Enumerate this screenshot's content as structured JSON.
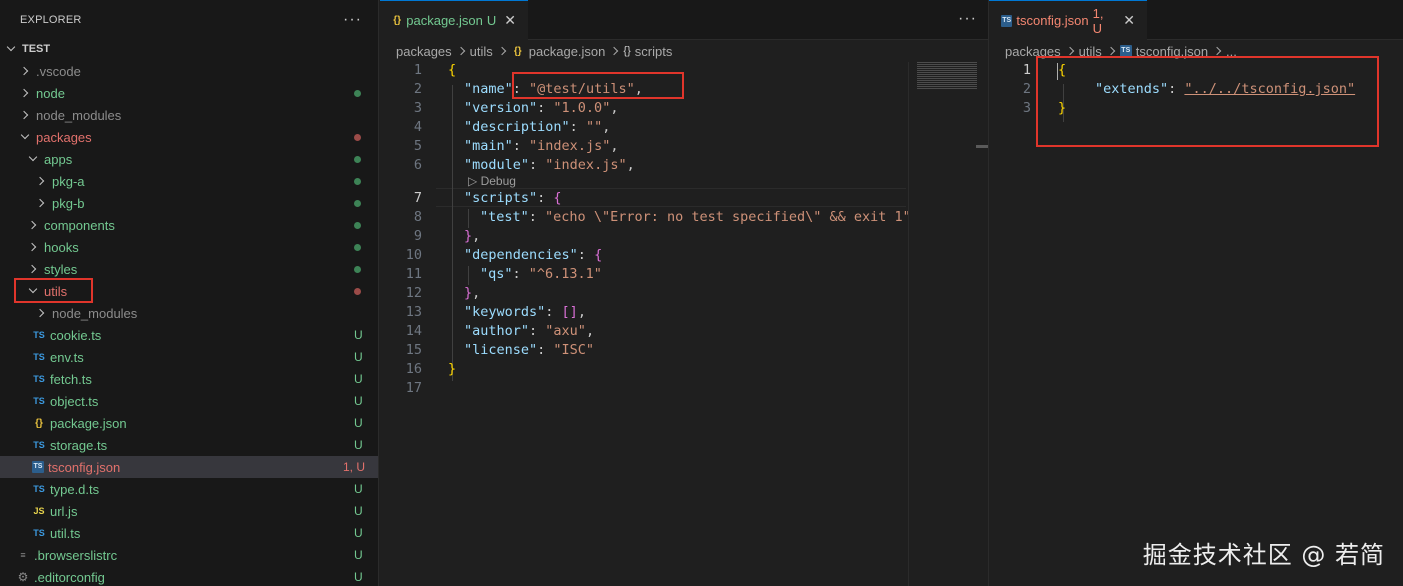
{
  "explorer": {
    "title": "EXPLORER",
    "more": "···",
    "root": "TEST",
    "items": [
      {
        "label": ".vscode",
        "type": "folder"
      },
      {
        "label": "node",
        "type": "folder"
      },
      {
        "label": "node_modules",
        "type": "folder"
      },
      {
        "label": "packages",
        "type": "folder"
      },
      {
        "label": "apps",
        "type": "folder"
      },
      {
        "label": "pkg-a",
        "type": "folder"
      },
      {
        "label": "pkg-b",
        "type": "folder"
      },
      {
        "label": "components",
        "type": "folder"
      },
      {
        "label": "hooks",
        "type": "folder"
      },
      {
        "label": "styles",
        "type": "folder"
      },
      {
        "label": "utils",
        "type": "folder"
      },
      {
        "label": "node_modules",
        "type": "folder"
      },
      {
        "label": "cookie.ts",
        "status": "U",
        "icon_text": "TS"
      },
      {
        "label": "env.ts",
        "status": "U",
        "icon_text": "TS"
      },
      {
        "label": "fetch.ts",
        "status": "U",
        "icon_text": "TS"
      },
      {
        "label": "object.ts",
        "status": "U",
        "icon_text": "TS"
      },
      {
        "label": "package.json",
        "status": "U",
        "icon_text": "{}"
      },
      {
        "label": "storage.ts",
        "status": "U",
        "icon_text": "TS"
      },
      {
        "label": "tsconfig.json",
        "status": "1, U",
        "icon_text": "TS"
      },
      {
        "label": "type.d.ts",
        "status": "U",
        "icon_text": "TS"
      },
      {
        "label": "url.js",
        "status": "U",
        "icon_text": "JS"
      },
      {
        "label": "util.ts",
        "status": "U",
        "icon_text": "TS"
      },
      {
        "label": ".browserslistrc",
        "status": "U",
        "icon_text": "≡"
      },
      {
        "label": ".editorconfig",
        "status": "U",
        "icon_text": "⚙"
      }
    ]
  },
  "left_editor": {
    "tab": {
      "label": "package.json",
      "status": "U",
      "icon_text": "{}",
      "close": "✕"
    },
    "more": "···",
    "breadcrumb": {
      "p1": "packages",
      "p2": "utils",
      "p3": "package.json",
      "p4": "scripts",
      "p3_icon": "{}",
      "p4_icon": "{}"
    },
    "codelens": "Debug",
    "line_numbers": [
      "1",
      "2",
      "3",
      "4",
      "5",
      "6",
      "7",
      "8",
      "9",
      "10",
      "11",
      "12",
      "13",
      "14",
      "15",
      "16",
      "17"
    ],
    "code": {
      "l1": "{",
      "name_key": "\"name\"",
      "name_val": "\"@test/utils\"",
      "version_key": "\"version\"",
      "version_val": "\"1.0.0\"",
      "desc_key": "\"description\"",
      "desc_val": "\"\"",
      "main_key": "\"main\"",
      "main_val": "\"index.js\"",
      "module_key": "\"module\"",
      "module_val": "\"index.js\"",
      "scripts_key": "\"scripts\"",
      "test_key": "\"test\"",
      "test_val": "\"echo \\\"Error: no test specified\\\" && exit 1\"",
      "deps_key": "\"dependencies\"",
      "qs_key": "\"qs\"",
      "qs_val": "\"^6.13.1\"",
      "keywords_key": "\"keywords\"",
      "author_key": "\"author\"",
      "author_val": "\"axu\"",
      "license_key": "\"license\"",
      "license_val": "\"ISC\"",
      "close": "}"
    }
  },
  "right_editor": {
    "tab": {
      "label": "tsconfig.json",
      "status": "1, U",
      "icon_text": "TS",
      "close": "✕"
    },
    "breadcrumb": {
      "p1": "packages",
      "p2": "utils",
      "p3": "tsconfig.json",
      "p4": "...",
      "p3_icon": "TS"
    },
    "line_numbers": [
      "1",
      "2",
      "3"
    ],
    "code": {
      "open": "{",
      "extends_key": "\"extends\"",
      "extends_val": "\"../../tsconfig.json\"",
      "close": "}"
    }
  },
  "watermark": "掘金技术社区 @ 若简"
}
